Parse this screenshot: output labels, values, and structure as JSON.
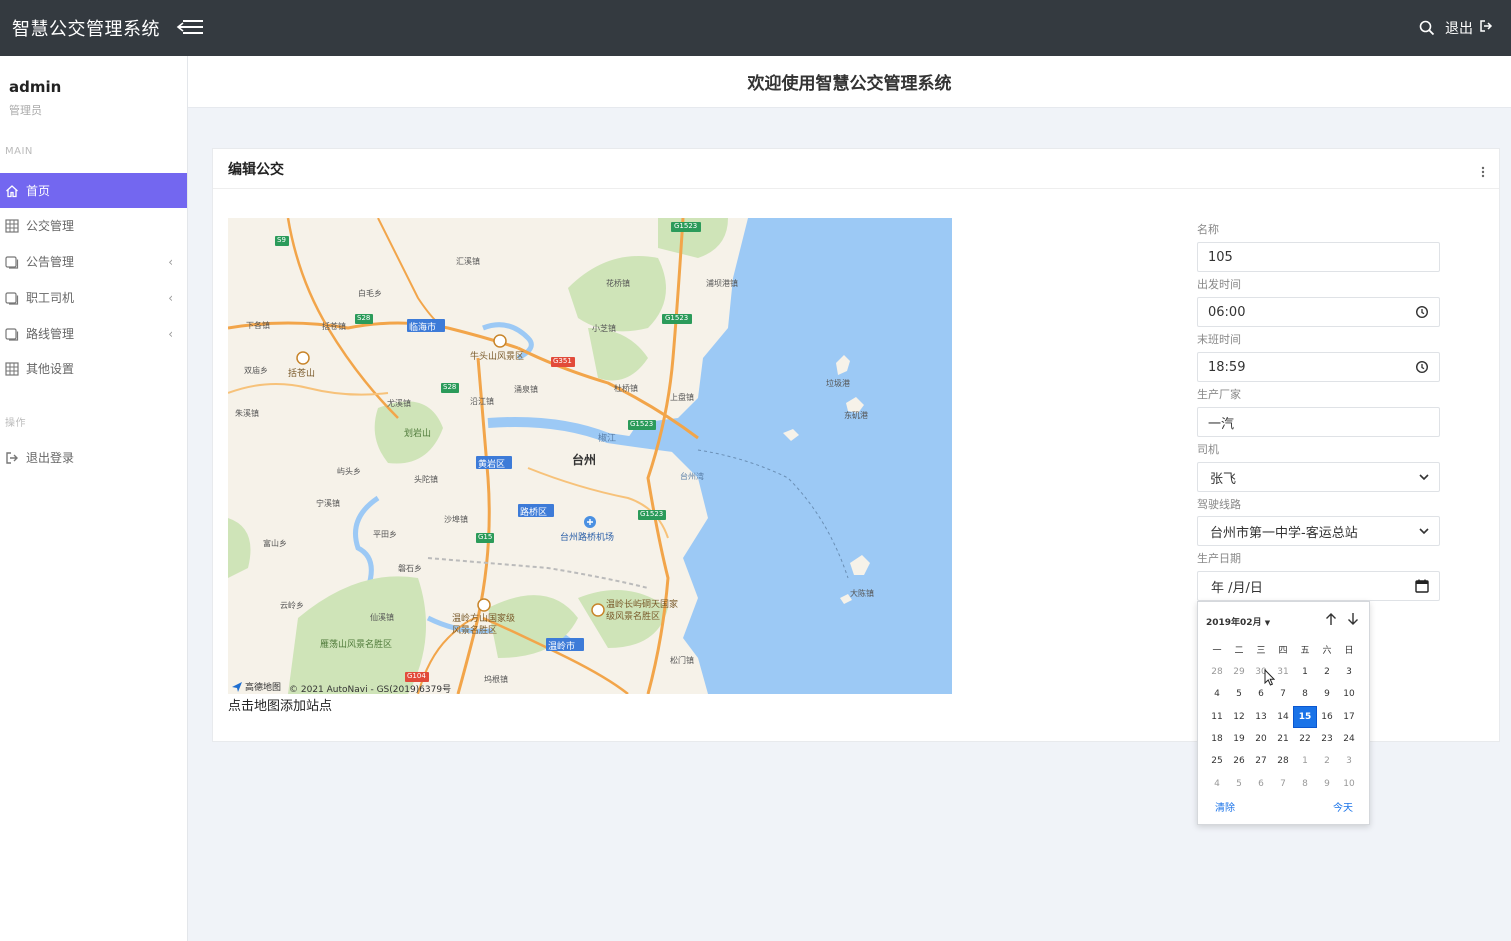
{
  "app": {
    "title": "智慧公交管理系统"
  },
  "topbar": {
    "logout_label": "退出"
  },
  "sidebar": {
    "user_name": "admin",
    "user_role": "管理员",
    "section_main": "MAIN",
    "section_ops": "操作",
    "items": [
      {
        "label": "首页",
        "icon": "home-icon",
        "active": true
      },
      {
        "label": "公交管理",
        "icon": "grid-icon"
      },
      {
        "label": "公告管理",
        "icon": "stack-icon",
        "chevron": "‹"
      },
      {
        "label": "职工司机",
        "icon": "stack-icon",
        "chevron": "‹"
      },
      {
        "label": "路线管理",
        "icon": "stack-icon",
        "chevron": "‹"
      },
      {
        "label": "其他设置",
        "icon": "grid-icon"
      }
    ],
    "logout_item": "退出登录"
  },
  "page": {
    "title": "欢迎使用智慧公交管理系统"
  },
  "card": {
    "title": "编辑公交"
  },
  "map": {
    "caption": "点击地图添加站点",
    "attribution_logo": "高德地图",
    "attribution": "© 2021 AutoNavi - GS(2019)6379号",
    "labels": {
      "taizhou": "台州",
      "linhai": "临海市",
      "huangyan": "黄岩区",
      "luqiao": "路桥区",
      "wenling": "温岭市",
      "airport": "台州路桥机场",
      "kuocangshan": "括苍山",
      "niutoushan": "牛头山风景区",
      "liuyanshan": "划岩山",
      "yandang": "雁荡山风景名胜区",
      "fangshan": "温岭方山国家级风景名胜区",
      "changyu": "温岭长屿硐天国家级风景名胜区",
      "dachen": "大陈镇",
      "taizhouwan": "台州湾",
      "yanjiang": "椒江",
      "lajigang": "垃圾港",
      "dongjigang": "东矶港",
      "huaqiao": "花桥镇",
      "xiaozhi": "小芝镇",
      "duqiao": "杜桥镇",
      "shangpan": "上盘镇",
      "puba": "浦坝港镇",
      "huixi": "汇溪镇",
      "baishuiyang": "白毛乡",
      "kuocang": "括苍镇",
      "xiage": "下各镇",
      "shuangmiao": "双庙乡",
      "zhuxi": "朱溪镇",
      "youxi": "尤溪镇",
      "yanjiangzhen": "沿江镇",
      "yongquan": "涌泉镇",
      "toutuo": "头陀镇",
      "dongtou": "屿头乡",
      "ningxi": "宁溪镇",
      "pingtian": "平田乡",
      "shaobu": "沙埠镇",
      "fushan": "富山乡",
      "yuntou": "云岭乡",
      "xianju": "仙溪镇",
      "panan": "磐石乡",
      "songmen": "松门镇",
      "jiaoshan": "坞根镇"
    },
    "shields": {
      "s9": "S9",
      "s28a": "S28",
      "s28b": "S28",
      "g351": "G351",
      "g1523a": "G1523",
      "g1523b": "G1523",
      "g1523c": "G1523",
      "g1523d": "G1523",
      "g15": "G15",
      "g104": "G104"
    }
  },
  "form": {
    "name": {
      "label": "名称",
      "value": "105"
    },
    "depart": {
      "label": "出发时间",
      "value": "06:00"
    },
    "last": {
      "label": "末班时间",
      "value": "18:59"
    },
    "maker": {
      "label": "生产厂家",
      "value": "一汽"
    },
    "driver": {
      "label": "司机",
      "value": "张飞"
    },
    "route": {
      "label": "驾驶线路",
      "value": "台州市第一中学-客运总站"
    },
    "date": {
      "label": "生产日期",
      "placeholder": "年 /月/日"
    }
  },
  "datepicker": {
    "month_label": "2019年02月",
    "weekdays": [
      "一",
      "二",
      "三",
      "四",
      "五",
      "六",
      "日"
    ],
    "weeks": [
      [
        "28",
        "29",
        "30",
        "31",
        "1",
        "2",
        "3"
      ],
      [
        "4",
        "5",
        "6",
        "7",
        "8",
        "9",
        "10"
      ],
      [
        "11",
        "12",
        "13",
        "14",
        "15",
        "16",
        "17"
      ],
      [
        "18",
        "19",
        "20",
        "21",
        "22",
        "23",
        "24"
      ],
      [
        "25",
        "26",
        "27",
        "28",
        "1",
        "2",
        "3"
      ],
      [
        "4",
        "5",
        "6",
        "7",
        "8",
        "9",
        "10"
      ]
    ],
    "selected": "15",
    "clear_label": "清除",
    "today_label": "今天"
  },
  "colors": {
    "accent": "#7367f0",
    "topbar": "#343a40",
    "sea": "#9cc9f5",
    "selected_day": "#1a73e8"
  }
}
